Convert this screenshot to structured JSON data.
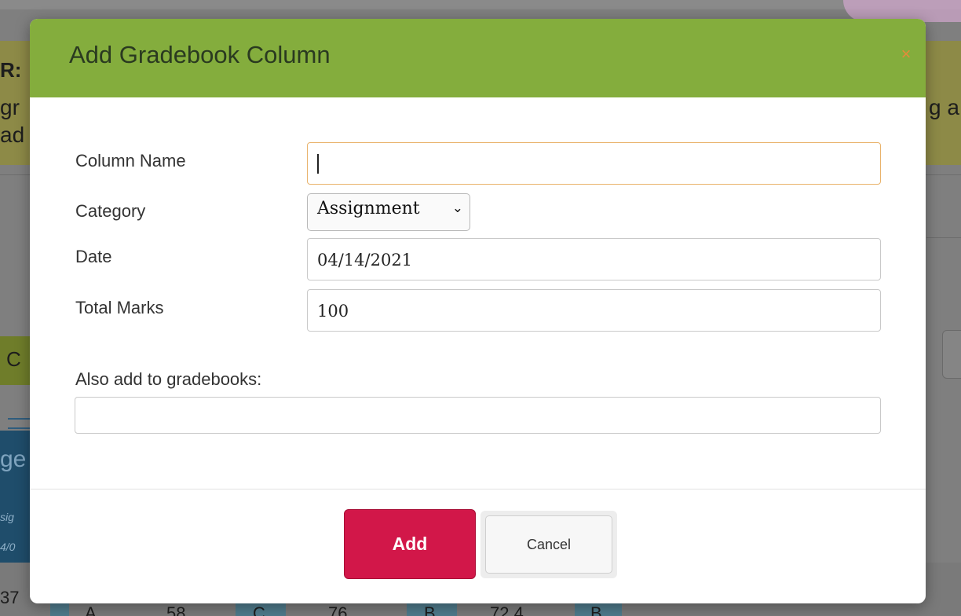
{
  "background": {
    "heading_fragment": "R:",
    "line1_left": "gr",
    "line2_left": "ad",
    "line1_right": "g a",
    "button_fragment": "C",
    "blue_title_fragment": "ge",
    "blue_italic_1": "sig",
    "blue_italic_2": "4/0",
    "bottom_number": "37",
    "bottom_cells": [
      "A",
      "58",
      "C",
      "76",
      "B",
      "72.4",
      "B"
    ]
  },
  "modal": {
    "title": "Add Gradebook Column",
    "close_symbol": "×",
    "column_name": {
      "label": "Column Name",
      "value": ""
    },
    "category": {
      "label": "Category",
      "selected": "Assignment"
    },
    "date": {
      "label": "Date",
      "value": "04/14/2021"
    },
    "total_marks": {
      "label": "Total Marks",
      "value": "100"
    },
    "also_add": {
      "label": "Also add to gradebooks:",
      "value": ""
    },
    "add_button": "Add",
    "cancel_button": "Cancel"
  },
  "colors": {
    "header_green": "#84ad3d",
    "add_red": "#d21749",
    "focus_orange": "#e9b36c"
  }
}
